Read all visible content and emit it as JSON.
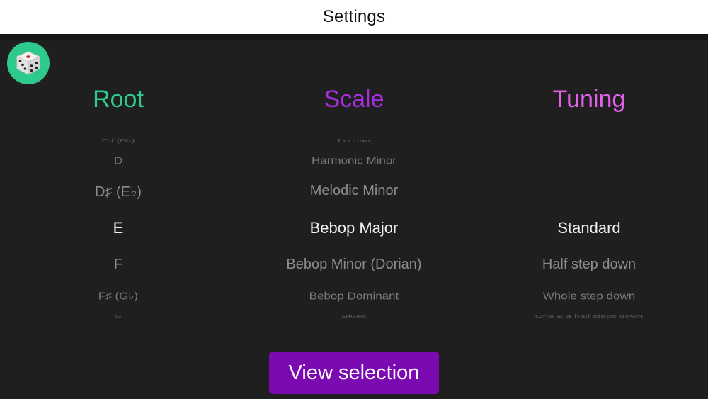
{
  "nav": {
    "title": "Settings"
  },
  "dice": {
    "icon": "dice-icon"
  },
  "columns": {
    "root": {
      "header": "Root",
      "color": "#2ec98c"
    },
    "scale": {
      "header": "Scale",
      "color": "#a52ee0"
    },
    "tuning": {
      "header": "Tuning",
      "color": "#e060e8"
    }
  },
  "pickers": {
    "root": {
      "items": [
        "C♯ (D♭)",
        "D",
        "D♯ (E♭)",
        "E",
        "F",
        "F♯ (G♭)",
        "G"
      ],
      "selected": "E"
    },
    "scale": {
      "items": [
        "Locrian",
        "Harmonic Minor",
        "Melodic Minor",
        "Bebop Major",
        "Bebop Minor (Dorian)",
        "Bebop Dominant",
        "Blues"
      ],
      "selected": "Bebop Major"
    },
    "tuning": {
      "items": [
        "Standard",
        "Half step down",
        "Whole step down",
        "One & a half steps down"
      ],
      "selected": "Standard"
    }
  },
  "action": {
    "view_label": "View selection"
  }
}
